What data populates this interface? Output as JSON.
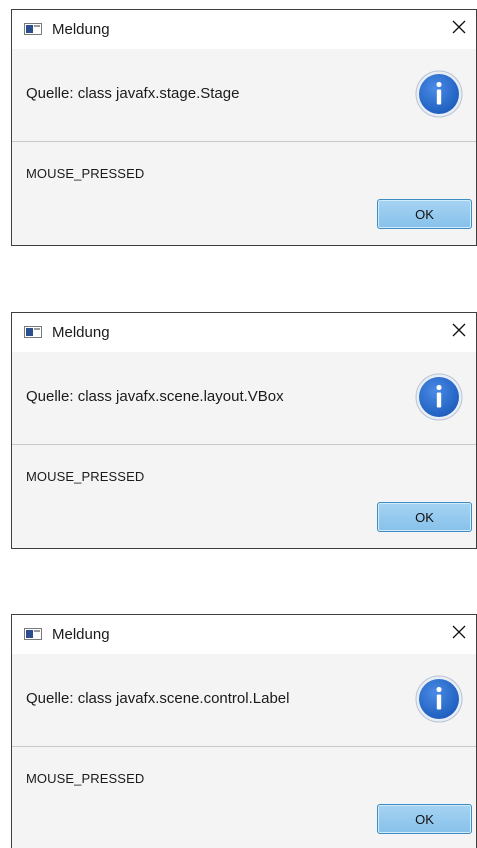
{
  "dialogs": [
    {
      "title": "Meldung",
      "message": "Quelle: class javafx.stage.Stage",
      "detail": "MOUSE_PRESSED",
      "ok_label": "OK"
    },
    {
      "title": "Meldung",
      "message": "Quelle: class javafx.scene.layout.VBox",
      "detail": "MOUSE_PRESSED",
      "ok_label": "OK"
    },
    {
      "title": "Meldung",
      "message": "Quelle: class javafx.scene.control.Label",
      "detail": "MOUSE_PRESSED",
      "ok_label": "OK"
    }
  ],
  "icons": {
    "app": "window-app-icon",
    "close": "close-icon",
    "info": "info-icon"
  },
  "colors": {
    "dialog_bg": "#f4f4f4",
    "ok_button": "#9ccdf0",
    "info_circle": "#2f6fd0"
  }
}
